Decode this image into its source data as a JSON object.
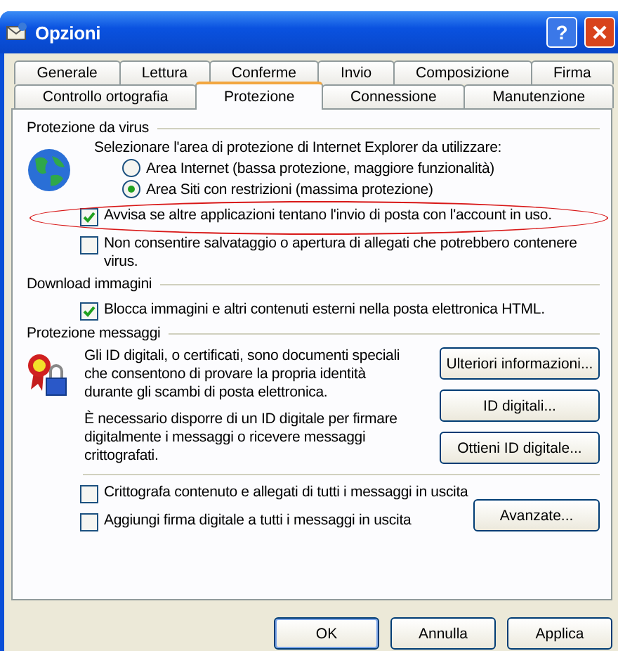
{
  "window": {
    "title": "Opzioni",
    "help_button": "?"
  },
  "tab_rows": [
    [
      {
        "label": "Generale",
        "selected": false
      },
      {
        "label": "Lettura",
        "selected": false
      },
      {
        "label": "Conferme",
        "selected": false
      },
      {
        "label": "Invio",
        "selected": false
      },
      {
        "label": "Composizione",
        "selected": false
      },
      {
        "label": "Firma",
        "selected": false
      }
    ],
    [
      {
        "label": "Controllo ortografia",
        "selected": false
      },
      {
        "label": "Protezione",
        "selected": true
      },
      {
        "label": "Connessione",
        "selected": false
      },
      {
        "label": "Manutenzione",
        "selected": false
      }
    ]
  ],
  "virus_protection": {
    "heading": "Protezione da virus",
    "intro": "Selezionare l'area di protezione di Internet Explorer da utilizzare:",
    "radios": [
      {
        "label": "Area Internet (bassa protezione, maggiore funzionalità)",
        "selected": false
      },
      {
        "label": "Area Siti con restrizioni (massima protezione)",
        "selected": true
      }
    ],
    "checkboxes": [
      {
        "label": "Avvisa se altre applicazioni tentano l'invio di posta con l'account in uso.",
        "checked": true,
        "circled": true
      },
      {
        "label": "Non consentire salvataggio o apertura di allegati che potrebbero contenere virus.",
        "checked": false,
        "circled": false
      }
    ]
  },
  "image_download": {
    "heading": "Download immagini",
    "checkboxes": [
      {
        "label": "Blocca immagini e altri contenuti esterni nella posta elettronica HTML.",
        "checked": true,
        "circled": false
      }
    ]
  },
  "message_protection": {
    "heading": "Protezione messaggi",
    "paragraphs": [
      "Gli ID digitali, o certificati, sono documenti speciali che consentono di provare la propria identità durante gli scambi di posta elettronica.",
      "È necessario disporre di un ID digitale per firmare digitalmente i messaggi o ricevere messaggi crittografati."
    ],
    "buttons": [
      "Ulteriori informazioni...",
      "ID digitali...",
      "Ottieni ID digitale..."
    ],
    "checkboxes": [
      {
        "label": "Crittografa contenuto e allegati di tutti i messaggi in uscita",
        "checked": false,
        "circled": false
      },
      {
        "label": "Aggiungi firma digitale a tutti i messaggi in uscita",
        "checked": false,
        "circled": false
      }
    ],
    "advanced_button": "Avanzate..."
  },
  "footer_buttons": [
    {
      "label": "OK",
      "default": true
    },
    {
      "label": "Annulla",
      "default": false
    },
    {
      "label": "Applica",
      "default": false
    }
  ]
}
